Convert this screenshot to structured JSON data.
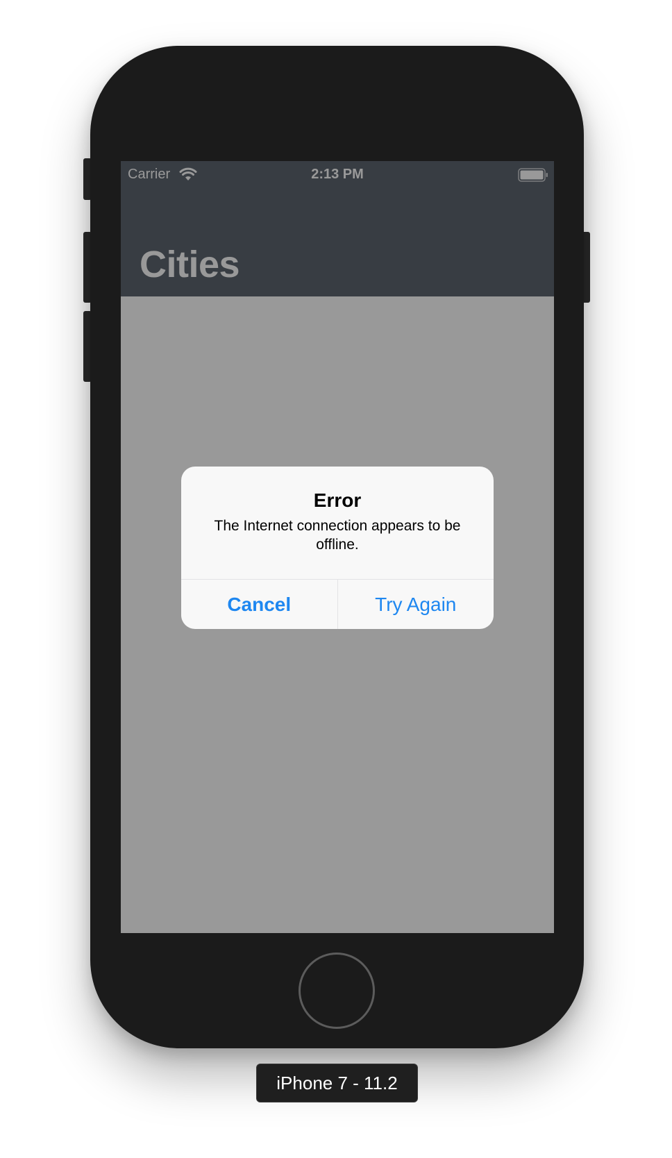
{
  "status_bar": {
    "carrier": "Carrier",
    "time": "2:13 PM",
    "wifi_icon": "wifi-icon",
    "battery_icon": "battery-icon"
  },
  "nav": {
    "title": "Cities",
    "color": "#5e6670"
  },
  "alert": {
    "title": "Error",
    "message": "The Internet connection appears to be offline.",
    "actions": [
      {
        "label": "Cancel",
        "style": "bold"
      },
      {
        "label": "Try Again",
        "style": "normal"
      }
    ],
    "tint": "#1e87f0"
  },
  "device": {
    "label": "iPhone 7 - 11.2"
  }
}
